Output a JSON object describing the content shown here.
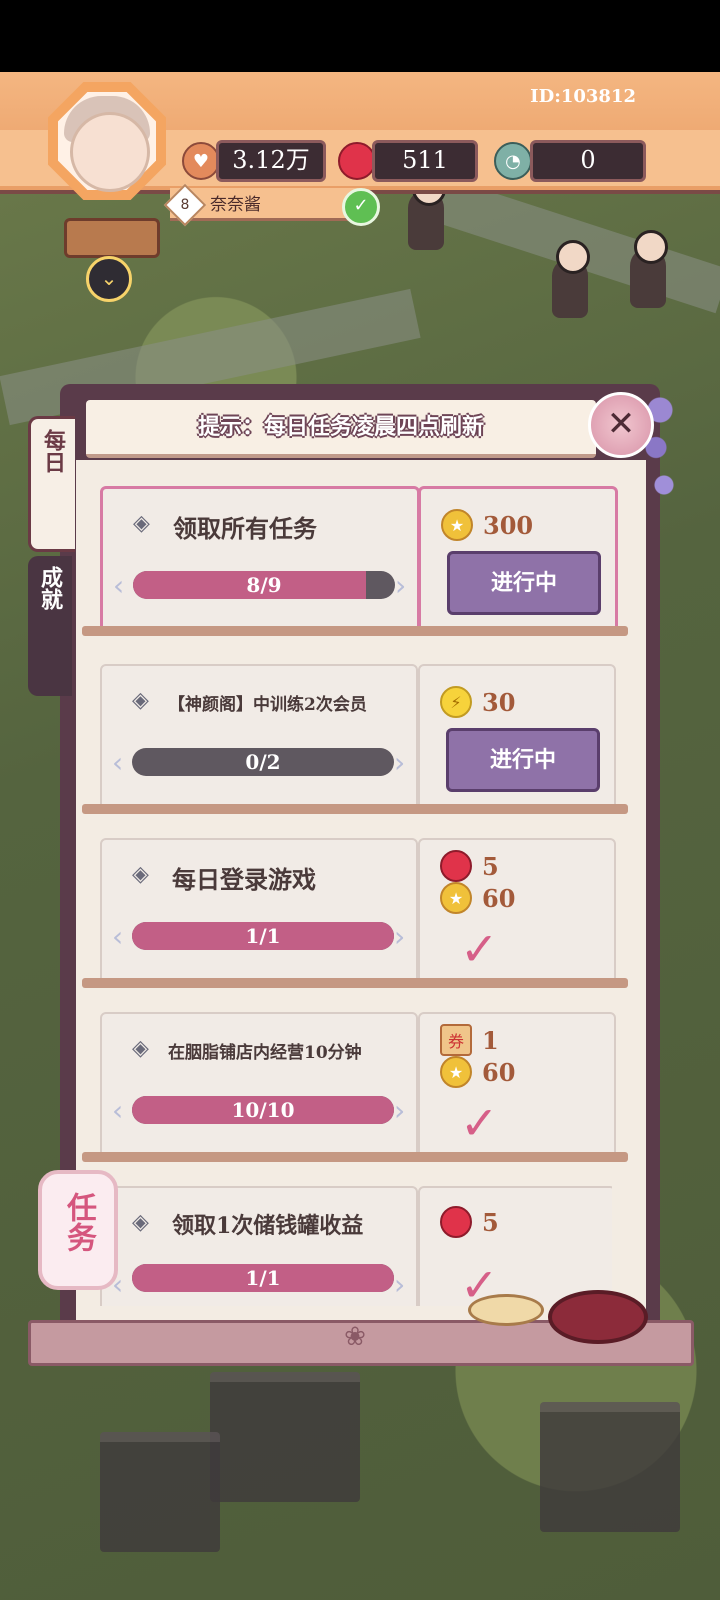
{
  "header": {
    "player_id": "ID:103812",
    "level": "8",
    "player_name": "奈奈酱",
    "resources": [
      {
        "icon": "heart-coin-icon",
        "value": "3.12万"
      },
      {
        "icon": "red-gem-icon",
        "value": "511"
      },
      {
        "icon": "clock-token-icon",
        "value": "0"
      }
    ]
  },
  "panel": {
    "title": "提示：每日任务凌晨四点刷新",
    "tabs": [
      {
        "label": "每日",
        "active": true
      },
      {
        "label": "成就",
        "active": false
      }
    ],
    "side_button": "任务"
  },
  "tasks": [
    {
      "title": "领取所有任务",
      "progress_text": "8/9",
      "progress": 0.89,
      "rewards": [
        {
          "icon": "star-icon",
          "amount": "300"
        }
      ],
      "status": "进行中",
      "done": false
    },
    {
      "title": "【神颜阁】中训练2次会员",
      "progress_text": "0/2",
      "progress": 0,
      "rewards": [
        {
          "icon": "lightning-icon",
          "amount": "30"
        }
      ],
      "status": "进行中",
      "done": false
    },
    {
      "title": "每日登录游戏",
      "progress_text": "1/1",
      "progress": 1,
      "rewards": [
        {
          "icon": "red-gem-icon",
          "amount": "5"
        },
        {
          "icon": "star-icon",
          "amount": "60"
        }
      ],
      "status": "",
      "done": true
    },
    {
      "title": "在胭脂铺店内经营10分钟",
      "progress_text": "10/10",
      "progress": 1,
      "rewards": [
        {
          "icon": "ticket-card-icon",
          "amount": "1"
        },
        {
          "icon": "star-icon",
          "amount": "60"
        }
      ],
      "status": "",
      "done": true
    },
    {
      "title": "领取1次储钱罐收益",
      "progress_text": "1/1",
      "progress": 1,
      "rewards": [
        {
          "icon": "red-gem-icon",
          "amount": "5"
        }
      ],
      "status": "",
      "done": true
    }
  ]
}
